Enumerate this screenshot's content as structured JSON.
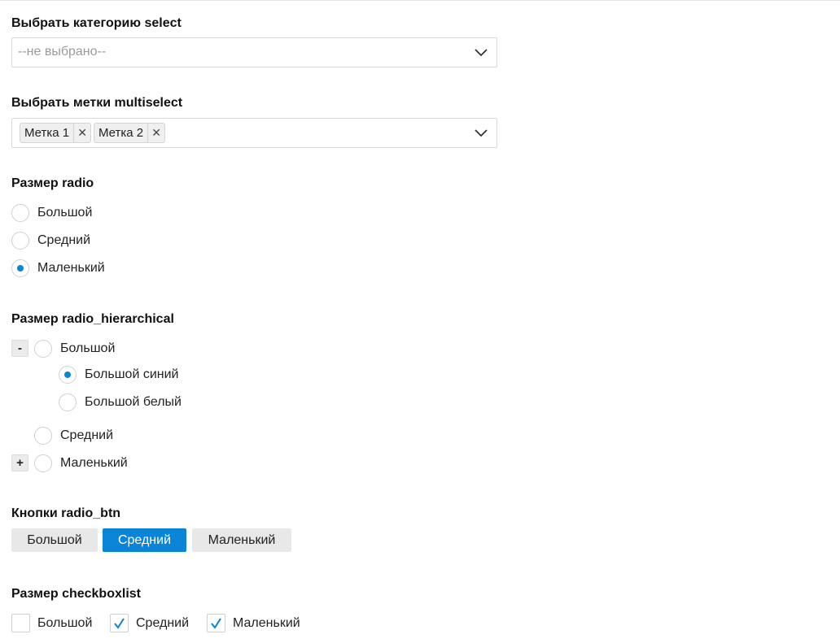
{
  "select": {
    "label": "Выбрать категорию select",
    "placeholder": "--не выбрано--",
    "icon": "chevron-down-icon"
  },
  "multiselect": {
    "label": "Выбрать метки multiselect",
    "tags": [
      "Метка 1",
      "Метка 2"
    ],
    "remove_glyph": "✕",
    "icon": "chevron-down-icon"
  },
  "radio": {
    "label": "Размер radio",
    "options": [
      "Большой",
      "Средний",
      "Маленький"
    ],
    "selected": "Маленький"
  },
  "radio_hierarchical": {
    "label": "Размер radio_hierarchical",
    "options": [
      {
        "label": "Большой",
        "toggle": "-",
        "expanded": true,
        "children": [
          {
            "label": "Большой синий",
            "selected": true
          },
          {
            "label": "Большой белый",
            "selected": false
          }
        ]
      },
      {
        "label": "Средний",
        "toggle": "",
        "expanded": false
      },
      {
        "label": "Маленький",
        "toggle": "+",
        "expanded": false
      }
    ]
  },
  "radio_btn": {
    "label": "Кнопки radio_btn",
    "buttons": [
      "Большой",
      "Средний",
      "Маленький"
    ],
    "active": "Средний"
  },
  "checkboxlist": {
    "label": "Размер checkboxlist",
    "items": [
      {
        "label": "Большой",
        "checked": false
      },
      {
        "label": "Средний",
        "checked": true
      },
      {
        "label": "Маленький",
        "checked": true
      }
    ]
  },
  "colors": {
    "accent": "#0a84d6",
    "button_bg": "#e8e8e8",
    "border": "#d9d9d9"
  }
}
